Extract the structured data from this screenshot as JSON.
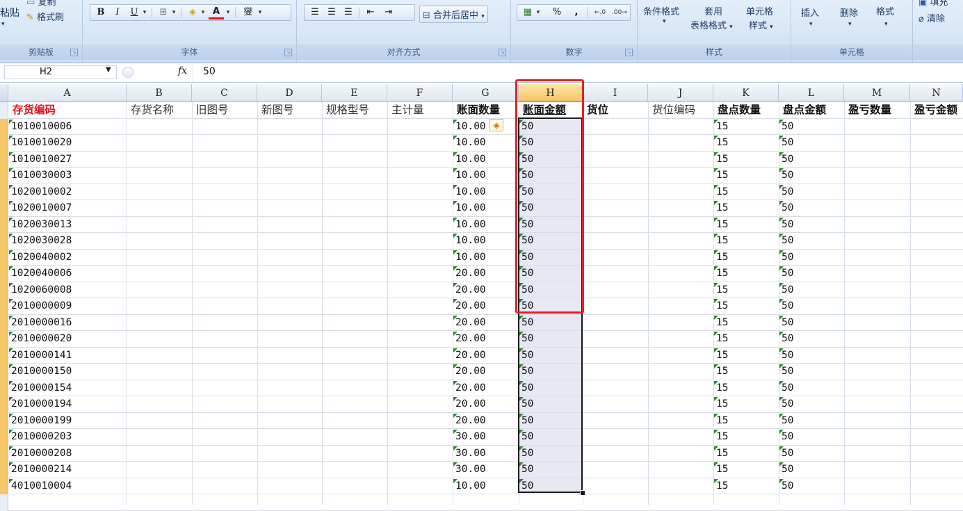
{
  "ribbon": {
    "clipboard": {
      "paste_label": "粘贴",
      "copy_label": "复制",
      "format_painter_label": "格式刷",
      "group_label": "剪贴板"
    },
    "font": {
      "bold": "B",
      "italic": "I",
      "underline": "U",
      "font_color_glyph": "A",
      "wen_glyph": "燮",
      "group_label": "字体"
    },
    "alignment": {
      "merge_center_label": "合并后居中",
      "group_label": "对齐方式"
    },
    "number": {
      "percent": "%",
      "comma": ",",
      "group_label": "数字"
    },
    "styles": {
      "conditional_label": "条件格式",
      "table_label_line1": "套用",
      "table_label_line2": "表格格式",
      "cell_style_line1": "单元格",
      "cell_style_line2": "样式",
      "group_label": "样式"
    },
    "cells": {
      "insert_label": "插入",
      "delete_label": "删除",
      "format_label": "格式",
      "group_label": "单元格"
    },
    "editing": {
      "fill_label": "填充",
      "clear_label": "清除"
    }
  },
  "formula_bar": {
    "name_box": "H2",
    "fx_label": "fx",
    "value": "50"
  },
  "columns": [
    "A",
    "B",
    "C",
    "D",
    "E",
    "F",
    "G",
    "H",
    "I",
    "J",
    "K",
    "L",
    "M",
    "N"
  ],
  "header_row": {
    "A": "存货编码",
    "B": "存货名称",
    "C": "旧图号",
    "D": "新图号",
    "E": "规格型号",
    "F": "主计量",
    "G": "账面数量",
    "H": "账面金额",
    "I": "货位",
    "J": "货位编码",
    "K": "盘点数量",
    "L": "盘点金额",
    "M": "盈亏数量",
    "N": "盈亏金额"
  },
  "rows": [
    {
      "A": "1010010006",
      "G": "10.00",
      "H": "50",
      "K": "15",
      "L": "50"
    },
    {
      "A": "1010010020",
      "G": "10.00",
      "H": "50",
      "K": "15",
      "L": "50"
    },
    {
      "A": "1010010027",
      "G": "10.00",
      "H": "50",
      "K": "15",
      "L": "50"
    },
    {
      "A": "1010030003",
      "G": "10.00",
      "H": "50",
      "K": "15",
      "L": "50"
    },
    {
      "A": "1020010002",
      "G": "10.00",
      "H": "50",
      "K": "15",
      "L": "50"
    },
    {
      "A": "1020010007",
      "G": "10.00",
      "H": "50",
      "K": "15",
      "L": "50"
    },
    {
      "A": "1020030013",
      "G": "10.00",
      "H": "50",
      "K": "15",
      "L": "50"
    },
    {
      "A": "1020030028",
      "G": "10.00",
      "H": "50",
      "K": "15",
      "L": "50"
    },
    {
      "A": "1020040002",
      "G": "10.00",
      "H": "50",
      "K": "15",
      "L": "50"
    },
    {
      "A": "1020040006",
      "G": "20.00",
      "H": "50",
      "K": "15",
      "L": "50"
    },
    {
      "A": "1020060008",
      "G": "20.00",
      "H": "50",
      "K": "15",
      "L": "50"
    },
    {
      "A": "2010000009",
      "G": "20.00",
      "H": "50",
      "K": "15",
      "L": "50"
    },
    {
      "A": "2010000016",
      "G": "20.00",
      "H": "50",
      "K": "15",
      "L": "50"
    },
    {
      "A": "2010000020",
      "G": "20.00",
      "H": "50",
      "K": "15",
      "L": "50"
    },
    {
      "A": "2010000141",
      "G": "20.00",
      "H": "50",
      "K": "15",
      "L": "50"
    },
    {
      "A": "2010000150",
      "G": "20.00",
      "H": "50",
      "K": "15",
      "L": "50"
    },
    {
      "A": "2010000154",
      "G": "20.00",
      "H": "50",
      "K": "15",
      "L": "50"
    },
    {
      "A": "2010000194",
      "G": "20.00",
      "H": "50",
      "K": "15",
      "L": "50"
    },
    {
      "A": "2010000199",
      "G": "20.00",
      "H": "50",
      "K": "15",
      "L": "50"
    },
    {
      "A": "2010000203",
      "G": "30.00",
      "H": "50",
      "K": "15",
      "L": "50"
    },
    {
      "A": "2010000208",
      "G": "30.00",
      "H": "50",
      "K": "15",
      "L": "50"
    },
    {
      "A": "2010000214",
      "G": "30.00",
      "H": "50",
      "K": "15",
      "L": "50"
    },
    {
      "A": "4010010004",
      "G": "10.00",
      "H": "50",
      "K": "15",
      "L": "50"
    }
  ],
  "colors": {
    "header_red": "#e8101c",
    "highlight_box": "#ec1c24",
    "selection_fill": "#e6e9f4",
    "error_triangle": "#2a8a2a"
  },
  "icons": [
    "copy-icon",
    "format-painter-icon",
    "border-icon",
    "fill-color-icon",
    "font-color-icon",
    "merge-center-icon",
    "currency-icon",
    "smart-tag-icon",
    "clear-icon",
    "fill-icon"
  ]
}
